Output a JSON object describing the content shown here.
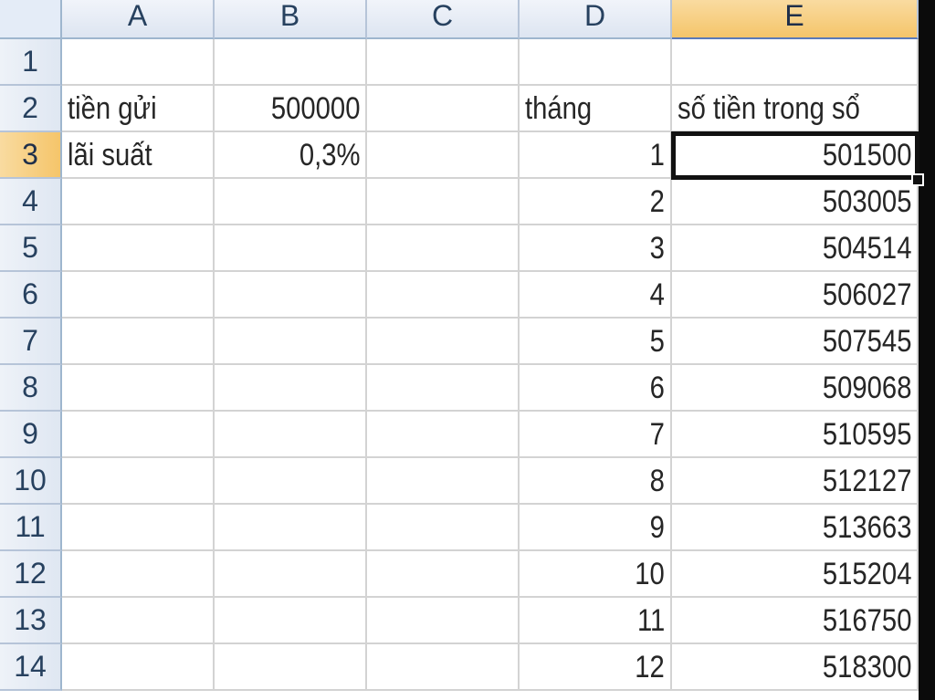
{
  "sheet": {
    "columns": [
      "A",
      "B",
      "C",
      "D",
      "E"
    ],
    "rows": [
      "1",
      "2",
      "3",
      "4",
      "5",
      "6",
      "7",
      "8",
      "9",
      "10",
      "11",
      "12",
      "13",
      "14"
    ],
    "selected_column": "E",
    "selected_row": "3",
    "active_cell": "E3",
    "cells": {
      "A2": "tiền gửi",
      "B2": "500000",
      "A3": "lãi suất",
      "B3": "0,3%",
      "D2": "tháng",
      "E2": "số tiền trong sổ"
    },
    "months": [
      "1",
      "2",
      "3",
      "4",
      "5",
      "6",
      "7",
      "8",
      "9",
      "10",
      "11",
      "12"
    ],
    "balances": [
      "501500",
      "503005",
      "504514",
      "506027",
      "507545",
      "509068",
      "510595",
      "512127",
      "513663",
      "515204",
      "516750",
      "518300"
    ]
  },
  "colors": {
    "header_selected": "#f5c56a",
    "header": "#dde5f1",
    "gridline": "#d3d3d3",
    "active_border": "#111111"
  }
}
